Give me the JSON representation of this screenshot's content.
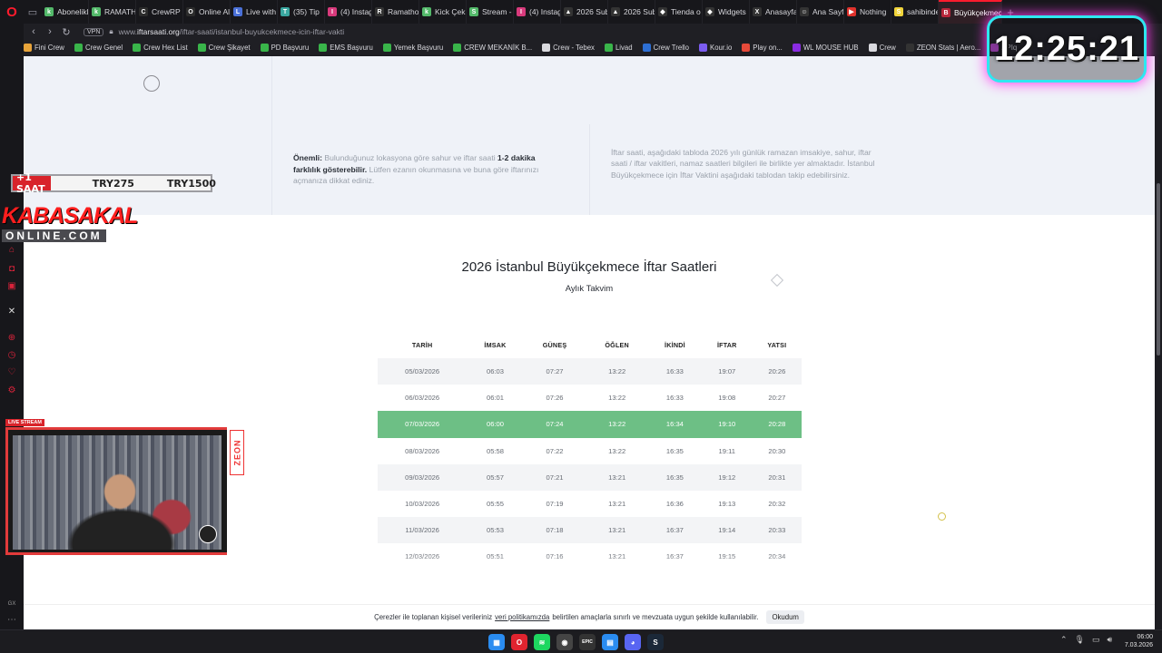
{
  "browser": {
    "tabs": [
      {
        "label": "Abonelikl",
        "color": "#53b96a",
        "icon": "k"
      },
      {
        "label": "RAMATH",
        "color": "#53b96a",
        "icon": "k"
      },
      {
        "label": "CrewRP",
        "color": "#2c2c2c",
        "icon": "C"
      },
      {
        "label": "Online Al",
        "color": "#2c2c2c",
        "icon": "O"
      },
      {
        "label": "Live with",
        "color": "#4a70d8",
        "icon": "L"
      },
      {
        "label": "(35) Tip",
        "color": "#3aa7a0",
        "icon": "T"
      },
      {
        "label": "(4) Instag",
        "color": "#d83a7c",
        "icon": "I"
      },
      {
        "label": "Ramatho",
        "color": "#333333",
        "icon": "R"
      },
      {
        "label": "Kick Çek",
        "color": "#53b96a",
        "icon": "k"
      },
      {
        "label": "Stream -",
        "color": "#53b96a",
        "icon": "S"
      },
      {
        "label": "(4) Instag",
        "color": "#d83a7c",
        "icon": "I"
      },
      {
        "label": "2026 Sub",
        "color": "#333333",
        "icon": "▲"
      },
      {
        "label": "2026 Sub",
        "color": "#333333",
        "icon": "▲"
      },
      {
        "label": "Tienda o",
        "color": "#333333",
        "icon": "◆"
      },
      {
        "label": "Widgets",
        "color": "#333333",
        "icon": "◆"
      },
      {
        "label": "Anasayfa",
        "color": "#333333",
        "icon": "X"
      },
      {
        "label": "Ana Sayfa",
        "color": "#333333",
        "icon": "☺"
      },
      {
        "label": "Nothing",
        "color": "#e0322c",
        "icon": "▶"
      },
      {
        "label": "sahibinde",
        "color": "#f0d43a",
        "icon": "S"
      },
      {
        "label": "Büyükçekmece İft",
        "color": "#b8263a",
        "icon": "B"
      }
    ],
    "url_prefix": "www.",
    "url_domain": "iftarsaati.org",
    "url_path": "/iftar-saati/istanbul-buyukcekmece-icin-iftar-vakti",
    "vpn_label": "VPN",
    "bookmarks": [
      {
        "label": "Fini Crew",
        "color": "#e8a43a"
      },
      {
        "label": "Crew Genel",
        "color": "#39b54a"
      },
      {
        "label": "Crew Hex List",
        "color": "#39b54a"
      },
      {
        "label": "Crew Şikayet",
        "color": "#39b54a"
      },
      {
        "label": "PD Başvuru",
        "color": "#39b54a"
      },
      {
        "label": "EMS Başvuru",
        "color": "#39b54a"
      },
      {
        "label": "Yemek Başvuru",
        "color": "#39b54a"
      },
      {
        "label": "CREW MEKANİK B...",
        "color": "#39b54a"
      },
      {
        "label": "Crew - Tebex",
        "color": "#d9d9de"
      },
      {
        "label": "Livad",
        "color": "#39b54a"
      },
      {
        "label": "Crew Trello",
        "color": "#2d6fd4"
      },
      {
        "label": "Kour.io",
        "color": "#7b5cf0"
      },
      {
        "label": "Play on...",
        "color": "#e64a3a"
      },
      {
        "label": "WL MOUSE HUB",
        "color": "#8a2be2"
      },
      {
        "label": "Crew",
        "color": "#d9d9de"
      },
      {
        "label": "ZEON Stats | Aero...",
        "color": "#333333"
      },
      {
        "label": "APIq",
        "color": "#c04ad8"
      }
    ]
  },
  "overlay": {
    "clock": "12:25:21",
    "price_tag": "+1 SAAT",
    "price_1": "TRY275",
    "price_2": "TRY1500",
    "logo_top": "KABASAKAL",
    "logo_bottom": "ONLINE.COM",
    "live_badge": "LIVE STREAM",
    "zeon": "ZEON"
  },
  "page": {
    "important_label": "Önemli:",
    "important_text1": " Bulunduğunuz lokasyona göre sahur ve iftar saati ",
    "important_bold": "1-2 dakika farklılık gösterebilir.",
    "important_text2": " Lütfen ezanın okunmasına ve buna göre iftarınızı açmanıza dikkat ediniz.",
    "description": "İftar saati, aşağıdaki tabloda 2026 yılı günlük ramazan imsakiye, sahur, iftar saati / iftar vakitleri, namaz saatleri bilgileri ile birlikte yer almaktadır. İstanbul Büyükçekmece için İftar Vaktini aşağıdaki tablodan takip edebilirsiniz.",
    "title": "2026 İstanbul Büyükçekmece İftar Saatleri",
    "subtitle": "Aylık Takvim",
    "columns": [
      "TARİH",
      "İMSAK",
      "GÜNEŞ",
      "ÖĞLEN",
      "İKİNDİ",
      "İFTAR",
      "YATSI"
    ],
    "rows": [
      [
        "05/03/2026",
        "06:03",
        "07:27",
        "13:22",
        "16:33",
        "19:07",
        "20:26"
      ],
      [
        "06/03/2026",
        "06:01",
        "07:26",
        "13:22",
        "16:33",
        "19:08",
        "20:27"
      ],
      [
        "07/03/2026",
        "06:00",
        "07:24",
        "13:22",
        "16:34",
        "19:10",
        "20:28"
      ],
      [
        "08/03/2026",
        "05:58",
        "07:22",
        "13:22",
        "16:35",
        "19:11",
        "20:30"
      ],
      [
        "09/03/2026",
        "05:57",
        "07:21",
        "13:21",
        "16:35",
        "19:12",
        "20:31"
      ],
      [
        "10/03/2026",
        "05:55",
        "07:19",
        "13:21",
        "16:36",
        "19:13",
        "20:32"
      ],
      [
        "11/03/2026",
        "05:53",
        "07:18",
        "13:21",
        "16:37",
        "19:14",
        "20:33"
      ],
      [
        "12/03/2026",
        "05:51",
        "07:16",
        "13:21",
        "16:37",
        "19:15",
        "20:34"
      ]
    ],
    "highlight_row": 2,
    "highlight_color": "#6dbf85",
    "cookie_text1": "Çerezler ile toplanan kişisel verileriniz",
    "cookie_link": "veri politikamızda",
    "cookie_text2": "belirtilen amaçlarla sınırlı ve mevzuata uygun şekilde kullanılabilir.",
    "cookie_button": "Okudum"
  },
  "taskbar": {
    "time": "06:00",
    "date": "7.03.2026",
    "apps": [
      {
        "name": "windows-start",
        "color": "#2a8cf0",
        "glyph": "▦"
      },
      {
        "name": "opera",
        "color": "#e0242f",
        "glyph": "O"
      },
      {
        "name": "spotify",
        "color": "#1ed760",
        "glyph": "≋"
      },
      {
        "name": "obs",
        "color": "#444444",
        "glyph": "◉"
      },
      {
        "name": "epic-games",
        "color": "#333333",
        "glyph": "EPIC"
      },
      {
        "name": "notepad",
        "color": "#2a8cf0",
        "glyph": "▤"
      },
      {
        "name": "discord",
        "color": "#5865f2",
        "glyph": "◕"
      },
      {
        "name": "steam",
        "color": "#1b2838",
        "glyph": "S"
      }
    ]
  }
}
